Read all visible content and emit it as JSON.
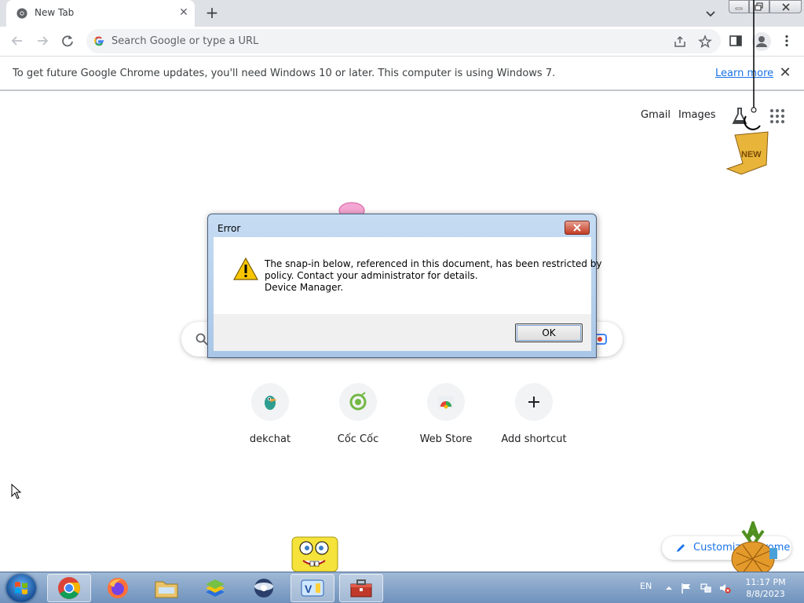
{
  "browser": {
    "tab_title": "New Tab",
    "omnibox_placeholder": "Search Google or type a URL"
  },
  "infobar": {
    "message": "To get future Google Chrome updates, you'll need Windows 10 or later. This computer is using Windows 7.",
    "link_text": "Learn more"
  },
  "ntp": {
    "header_links": [
      "Gmail",
      "Images"
    ],
    "shortcuts": [
      {
        "label": "dekchat",
        "icon": "dekchat-icon"
      },
      {
        "label": "Cốc Cốc",
        "icon": "coccoc-icon"
      },
      {
        "label": "Web Store",
        "icon": "webstore-icon"
      },
      {
        "label": "Add shortcut",
        "icon": "plus-icon"
      }
    ],
    "customize_label": "Customize Chrome"
  },
  "dialog": {
    "title": "Error",
    "message_line1": "The snap-in below, referenced in this document, has been restricted by",
    "message_line2": "policy. Contact your administrator for details.",
    "message_line3": "Device Manager.",
    "ok_label": "OK"
  },
  "taskbar": {
    "apps": [
      "chrome",
      "firefox",
      "file-explorer",
      "bluestacks",
      "network-app",
      "unikey",
      "control-panel"
    ],
    "language": "EN",
    "time": "11:17 PM",
    "date": "8/8/2023"
  },
  "colors": {
    "accent": "#1a73e8",
    "tabstrip": "#dee1e6",
    "taskbar": "#7a9bc4"
  }
}
